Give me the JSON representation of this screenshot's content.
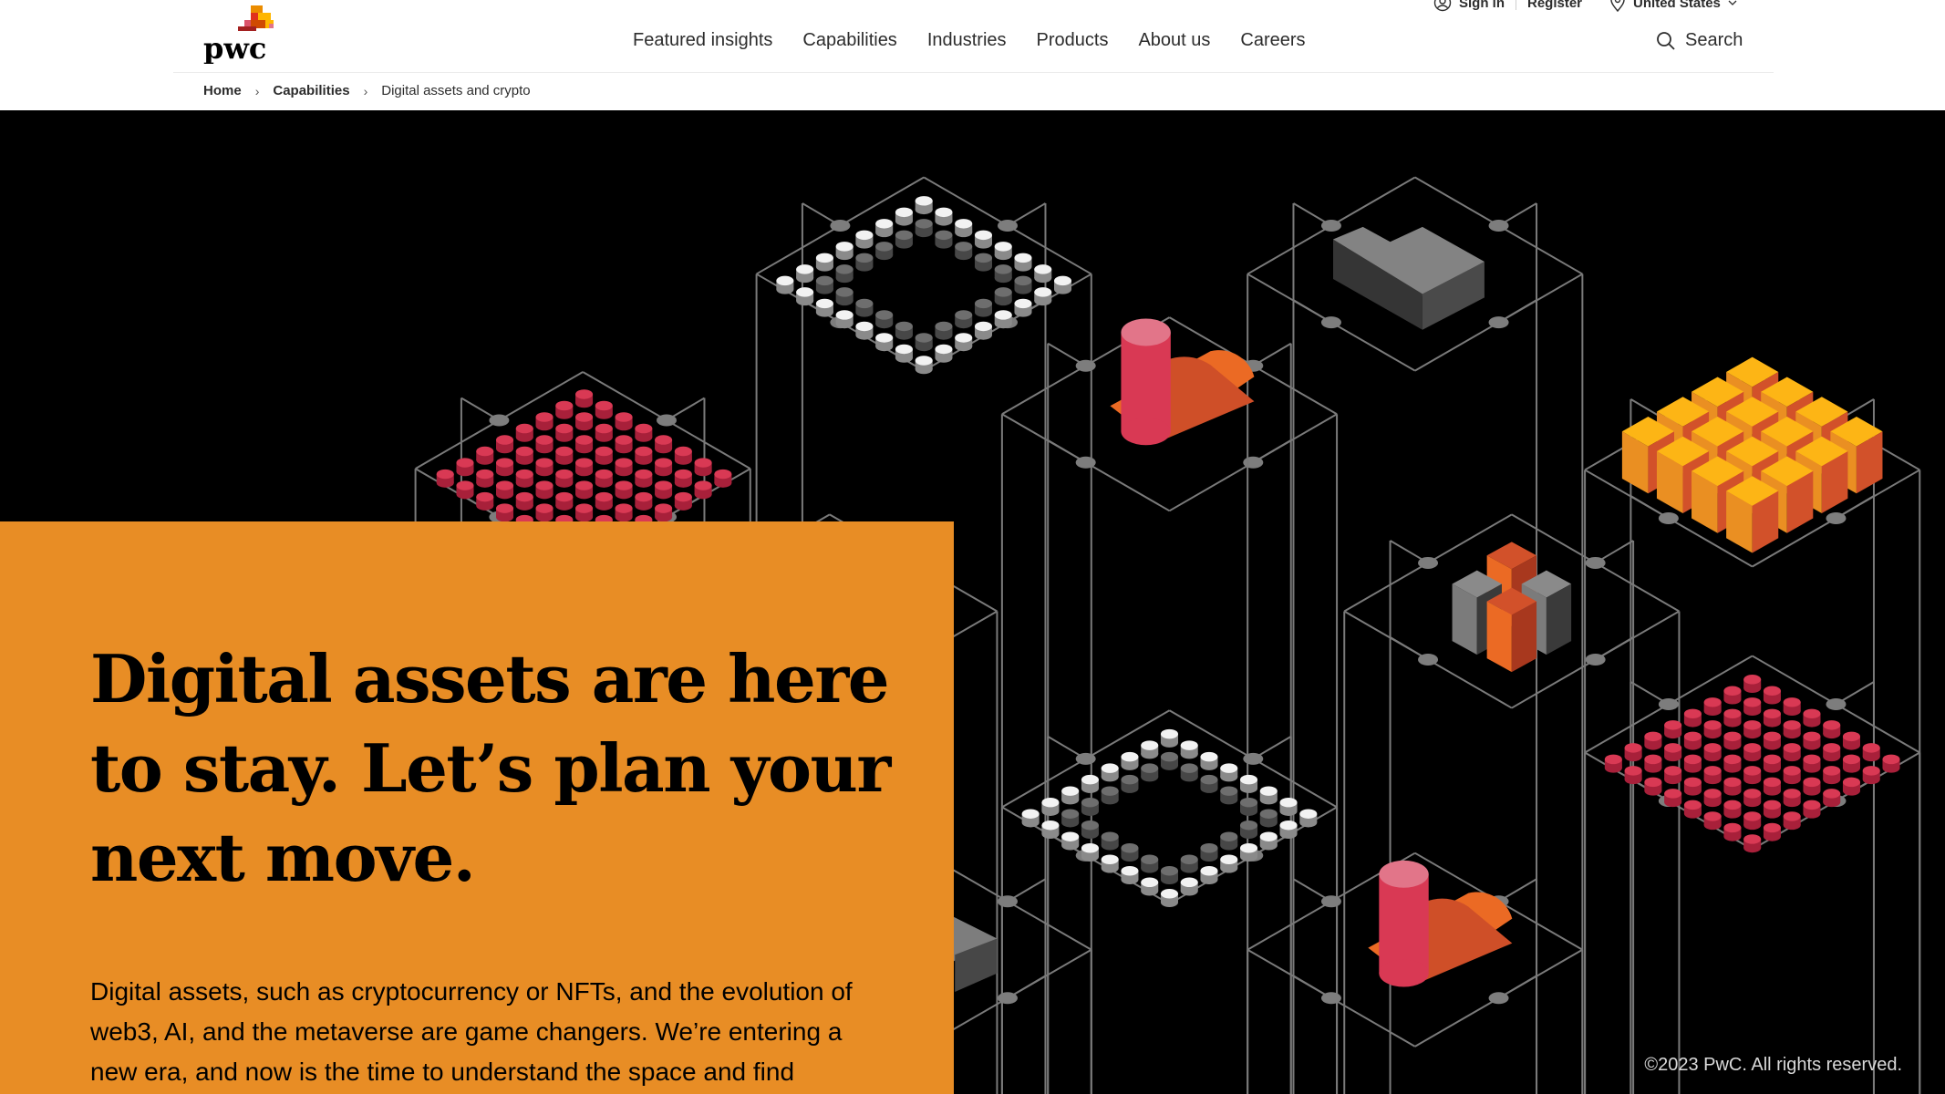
{
  "brand": {
    "name": "pwc",
    "logo_icon": "pwc-logo"
  },
  "utility_nav": {
    "sign_in": {
      "label": "Sign in",
      "icon": "user-circle-icon"
    },
    "register": {
      "label": "Register"
    },
    "region": {
      "label": "United States",
      "icon": "location-pin-icon",
      "caret": "chevron-down-icon"
    }
  },
  "main_nav": {
    "items": [
      {
        "label": "Featured insights"
      },
      {
        "label": "Capabilities"
      },
      {
        "label": "Industries"
      },
      {
        "label": "Products"
      },
      {
        "label": "About us"
      },
      {
        "label": "Careers"
      }
    ],
    "search": {
      "label": "Search",
      "icon": "search-icon"
    }
  },
  "breadcrumb": {
    "items": [
      {
        "label": "Home"
      },
      {
        "label": "Capabilities"
      },
      {
        "label": "Digital assets and crypto"
      }
    ],
    "separator": "›"
  },
  "hero": {
    "title": "Digital assets are here to stay. Let’s plan your next move.",
    "body": "Digital assets, such as cryptocurrency or NFTs, and the evolution of web3, AI, and the metaverse are game changers. We’re entering a new era, and now is the time to understand the space and find",
    "panel_color": "#e88d25",
    "background_color": "#000000",
    "illustration": "isometric-digital-assets-grid",
    "copyright": "©2023 PwC. All rights reserved."
  },
  "colors": {
    "red": "#d93954",
    "orange": "#eb6a24",
    "yellow": "#fdb515",
    "grey": "#7d7d7d",
    "line": "#7a7a7a"
  }
}
